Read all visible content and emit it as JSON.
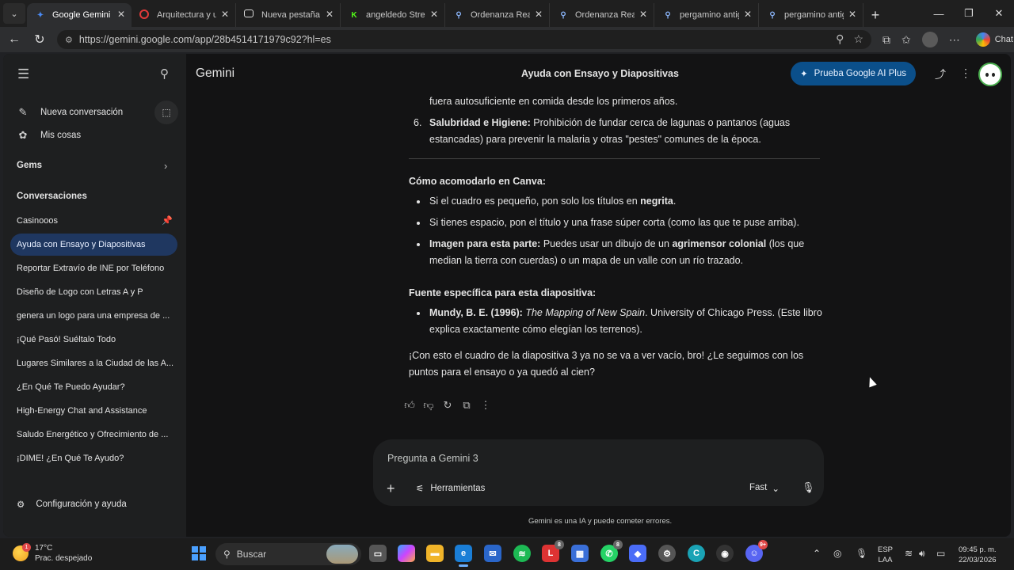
{
  "browser": {
    "tabs": [
      {
        "label": "Google Gemini",
        "icon": "gemini-icon",
        "color": "#4a8af4",
        "active": true
      },
      {
        "label": "Arquitectura y urba",
        "icon": "opera-icon",
        "color": "#e03a3a"
      },
      {
        "label": "Nueva pestaña",
        "icon": "newtab-icon",
        "color": "#ddd"
      },
      {
        "label": "angeldedo Stream",
        "icon": "kick-icon",
        "color": "#53fc18"
      },
      {
        "label": "Ordenanza Real de",
        "icon": "search-icon",
        "color": "#8ab4f8"
      },
      {
        "label": "Ordenanza Real de",
        "icon": "search-icon",
        "color": "#8ab4f8"
      },
      {
        "label": "pergamino antiguo",
        "icon": "search-icon",
        "color": "#8ab4f8"
      },
      {
        "label": "pergamino antiguo",
        "icon": "search-icon",
        "color": "#8ab4f8"
      }
    ],
    "url": "https://gemini.google.com/app/28b4514171979c92?hl=es",
    "chat_label": "Chat"
  },
  "sidebar": {
    "new_chat": "Nueva conversación",
    "my_stuff": "Mis cosas",
    "gems": "Gems",
    "conversations_heading": "Conversaciones",
    "items": [
      "Casinooos",
      "Ayuda con Ensayo y Diapositivas",
      "Reportar Extravío de INE por Teléfono",
      "Diseño de Logo con Letras A y P",
      "genera un logo para una empresa de ...",
      "¡Qué Pasó! Suéltalo Todo",
      "Lugares Similares a la Ciudad de las A...",
      "¿En Qué Te Puedo Ayudar?",
      "High-Energy Chat and Assistance",
      "Saludo Energético y Ofrecimiento de ...",
      "¡DIME! ¿En Qué Te Ayudo?"
    ],
    "settings": "Configuración y ayuda"
  },
  "header": {
    "brand": "Gemini",
    "title": "Ayuda con Ensayo y Diapositivas",
    "upgrade": "Prueba Google AI Plus"
  },
  "message": {
    "line_top": "fuera autosuficiente en comida desde los primeros años.",
    "item6_num": "6.",
    "item6_bold": "Salubridad e Higiene:",
    "item6_rest1": "Prohibición de fundar cerca de lagunas o pantanos (aguas",
    "item6_rest2": "estancadas) para prevenir la malaria y otras \"pestes\" comunes de la época.",
    "canva_heading": "Cómo acomodarlo en Canva:",
    "b1_pre": "Si el cuadro es pequeño, pon solo los títulos en ",
    "b1_bold": "negrita",
    "b1_post": ".",
    "b2": "Si tienes espacio, pon el título y una frase súper corta (como las que te puse arriba).",
    "b3_bold": "Imagen para esta parte:",
    "b3_mid": " Puedes usar un dibujo de un ",
    "b3_bold2": "agrimensor colonial",
    "b3_end": " (los que",
    "b3_line2": "median la tierra con cuerdas) o un mapa de un valle con un río trazado.",
    "source_heading": "Fuente específica para esta diapositiva:",
    "src_bold": "Mundy, B. E. (1996):",
    "src_ital": "The Mapping of New Spain",
    "src_rest": ". University of Chicago Press. (Este libro",
    "src_line2": "explica exactamente cómo elegían los terrenos).",
    "closing1": "¡Con esto el cuadro de la diapositiva 3 ya no se va a ver vacío, bro! ¿Le seguimos con los",
    "closing2": "puntos para el ensayo o ya quedó al cien?"
  },
  "composer": {
    "placeholder": "Pregunta a Gemini 3",
    "tools": "Herramientas",
    "mode": "Fast",
    "disclaimer": "Gemini es una IA y puede cometer errores."
  },
  "taskbar": {
    "temp": "17°C",
    "weather": "Prac. despejado",
    "weather_badge": "1",
    "search": "Buscar",
    "lang1": "ESP",
    "lang2": "LAA",
    "time": "09:45 p. m.",
    "date": "22/03/2026",
    "badge_a": "8",
    "badge_b": "8",
    "badge_c": "9+"
  }
}
